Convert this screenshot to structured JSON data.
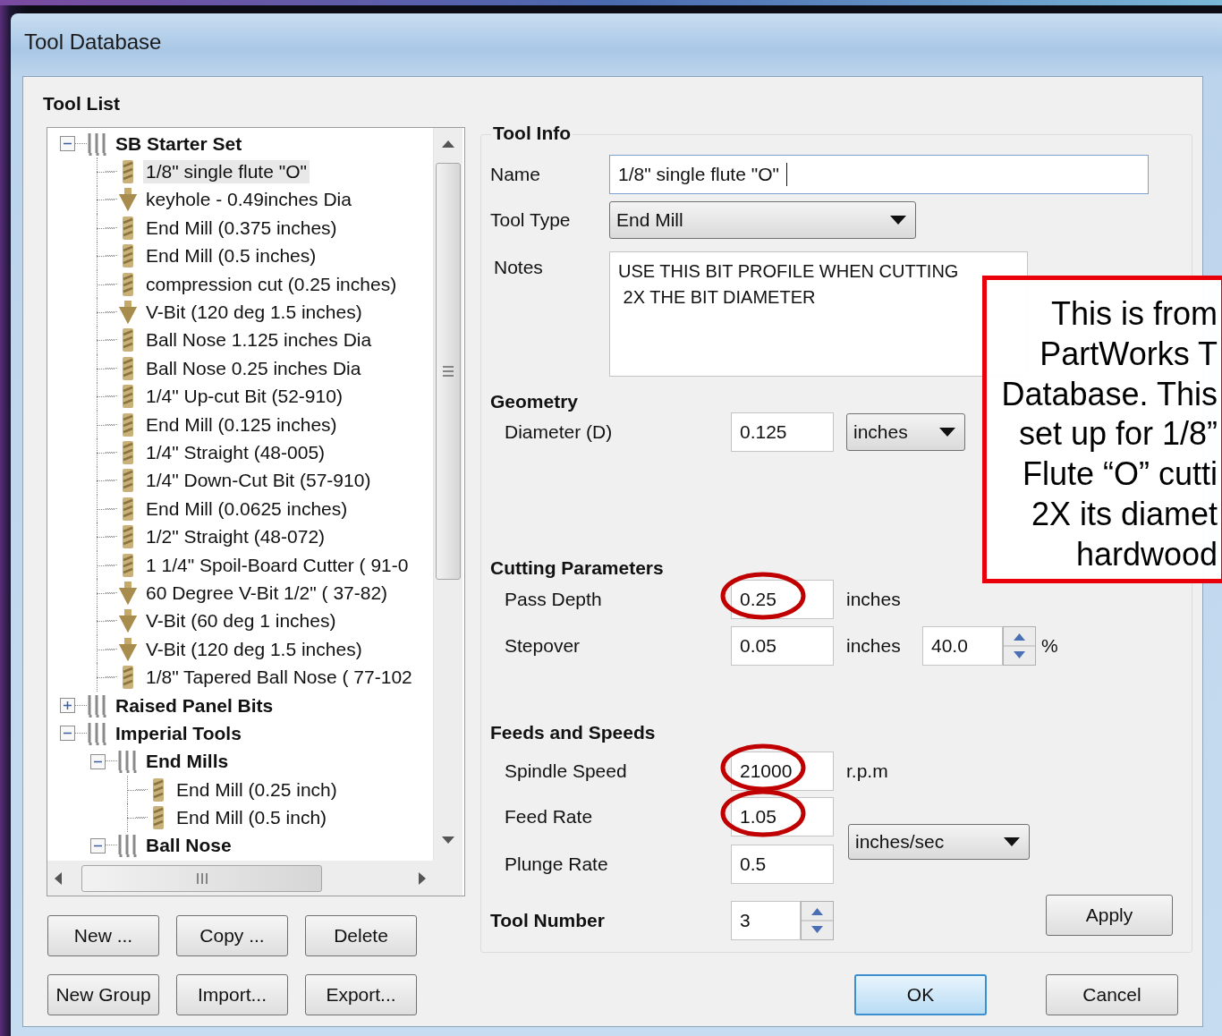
{
  "window": {
    "title": "Tool Database"
  },
  "tool_list": {
    "title": "Tool List",
    "tree": [
      {
        "label": "SB Starter Set",
        "kind": "group",
        "expanded": true,
        "selected": false,
        "children": [
          {
            "label": "1/8\" single flute \"O\"",
            "kind": "straight",
            "selected": true
          },
          {
            "label": "keyhole - 0.49inches Dia",
            "kind": "vbit",
            "selected": false
          },
          {
            "label": "End Mill (0.375 inches)",
            "kind": "straight",
            "selected": false
          },
          {
            "label": "End Mill (0.5 inches)",
            "kind": "straight",
            "selected": false
          },
          {
            "label": "compression cut (0.25 inches)",
            "kind": "straight",
            "selected": false
          },
          {
            "label": "V-Bit (120 deg 1.5 inches)",
            "kind": "vbit",
            "selected": false
          },
          {
            "label": "Ball Nose 1.125 inches Dia",
            "kind": "straight",
            "selected": false
          },
          {
            "label": "Ball Nose 0.25 inches Dia",
            "kind": "straight",
            "selected": false
          },
          {
            "label": " 1/4\" Up-cut Bit (52-910)",
            "kind": "straight",
            "selected": false
          },
          {
            "label": "End Mill (0.125 inches)",
            "kind": "straight",
            "selected": false
          },
          {
            "label": "1/4\" Straight  (48-005)",
            "kind": "straight",
            "selected": false
          },
          {
            "label": "1/4\"  Down-Cut Bit (57-910)",
            "kind": "straight",
            "selected": false
          },
          {
            "label": "End Mill (0.0625 inches)",
            "kind": "straight",
            "selected": false
          },
          {
            "label": "1/2\" Straight  (48-072)",
            "kind": "straight",
            "selected": false
          },
          {
            "label": "1 1/4\" Spoil-Board Cutter ( 91-0",
            "kind": "straight",
            "selected": false
          },
          {
            "label": "60 Degree V-Bit 1/2\"  ( 37-82)",
            "kind": "vbit",
            "selected": false
          },
          {
            "label": "V-Bit (60 deg 1 inches)",
            "kind": "vbit",
            "selected": false
          },
          {
            "label": "V-Bit (120 deg 1.5 inches)",
            "kind": "vbit",
            "selected": false
          },
          {
            "label": "1/8\" Tapered Ball Nose ( 77-102",
            "kind": "straight",
            "selected": false
          }
        ]
      },
      {
        "label": "Raised Panel Bits",
        "kind": "group",
        "expanded": false,
        "selected": false
      },
      {
        "label": "Imperial Tools",
        "kind": "group",
        "expanded": true,
        "selected": false,
        "children": [
          {
            "label": "End Mills",
            "kind": "group",
            "expanded": true,
            "selected": false,
            "children": [
              {
                "label": "End Mill (0.25 inch)",
                "kind": "straight",
                "selected": false
              },
              {
                "label": "End Mill (0.5 inch)",
                "kind": "straight",
                "selected": false
              }
            ]
          },
          {
            "label": "Ball Nose",
            "kind": "group",
            "expanded": true,
            "selected": false
          }
        ]
      }
    ],
    "button_rows": [
      [
        "New ...",
        "Copy ...",
        "Delete"
      ],
      [
        "New Group",
        "Import...",
        "Export..."
      ]
    ]
  },
  "tool_info": {
    "title": "Tool Info",
    "name": {
      "label": "Name",
      "value": "1/8\" single flute \"O\""
    },
    "tool_type": {
      "label": "Tool Type",
      "value": "End Mill"
    },
    "notes": {
      "label": "Notes",
      "value": "USE THIS BIT PROFILE WHEN CUTTING\n 2X THE BIT DIAMETER"
    },
    "geometry": {
      "title": "Geometry",
      "diameter": {
        "label": "Diameter (D)",
        "value": "0.125",
        "unit": "inches",
        "circled": false
      }
    },
    "cutting": {
      "title": "Cutting Parameters",
      "pass_depth": {
        "label": "Pass Depth",
        "value": "0.25",
        "unit": "inches",
        "circled": true
      },
      "stepover": {
        "label": "Stepover",
        "value": "0.05",
        "unit": "inches",
        "percent": "40.0",
        "percent_unit": "%",
        "circled": false
      }
    },
    "feeds": {
      "title": "Feeds and Speeds",
      "spindle_speed": {
        "label": "Spindle Speed",
        "value": "21000",
        "unit": "r.p.m",
        "circled": true
      },
      "feed_rate": {
        "label": "Feed Rate",
        "value": "1.05",
        "circled": true
      },
      "plunge_rate": {
        "label": "Plunge Rate",
        "value": "0.5",
        "circled": false
      },
      "rate_unit": "inches/sec"
    },
    "tool_number": {
      "label": "Tool Number",
      "value": "3"
    },
    "apply": "Apply"
  },
  "dialog_buttons": [
    {
      "label": "OK",
      "default": true
    },
    {
      "label": "Cancel",
      "default": false
    }
  ],
  "callout": {
    "lines": [
      "This is from",
      "PartWorks T",
      "Database. This",
      "set up for 1/8”",
      "Flute “O” cutti",
      "2X its diamet",
      "hardwood"
    ]
  }
}
